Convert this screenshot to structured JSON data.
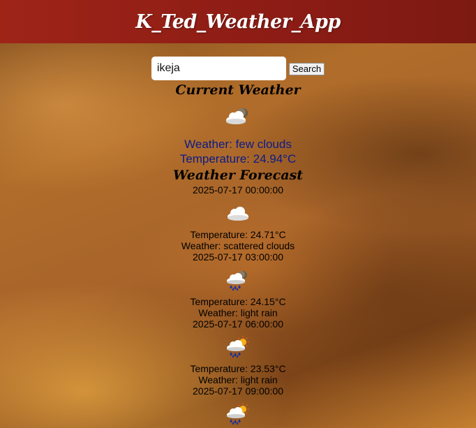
{
  "header": {
    "title": "K_Ted_Weather_App"
  },
  "search": {
    "value": "ikeja",
    "button_label": "Search"
  },
  "current": {
    "heading": "Current Weather",
    "icon": "few-clouds-night-icon",
    "weather_text": "Weather: few clouds",
    "temperature_text": "Temperature: 24.94°C"
  },
  "forecast": {
    "heading": "Weather Forecast",
    "first_time": "2025-07-17 00:00:00",
    "items": [
      {
        "icon": "scattered-clouds-icon",
        "temperature": "Temperature: 24.71°C",
        "weather": "Weather: scattered clouds",
        "next_time": "2025-07-17 03:00:00"
      },
      {
        "icon": "rain-night-icon",
        "temperature": "Temperature: 24.15°C",
        "weather": "Weather: light rain",
        "next_time": "2025-07-17 06:00:00"
      },
      {
        "icon": "rain-day-icon",
        "temperature": "Temperature: 23.53°C",
        "weather": "Weather: light rain",
        "next_time": "2025-07-17 09:00:00"
      },
      {
        "icon": "rain-day-icon"
      }
    ]
  },
  "colors": {
    "header": "#8c1c15",
    "current_text": "#0c1b86"
  }
}
